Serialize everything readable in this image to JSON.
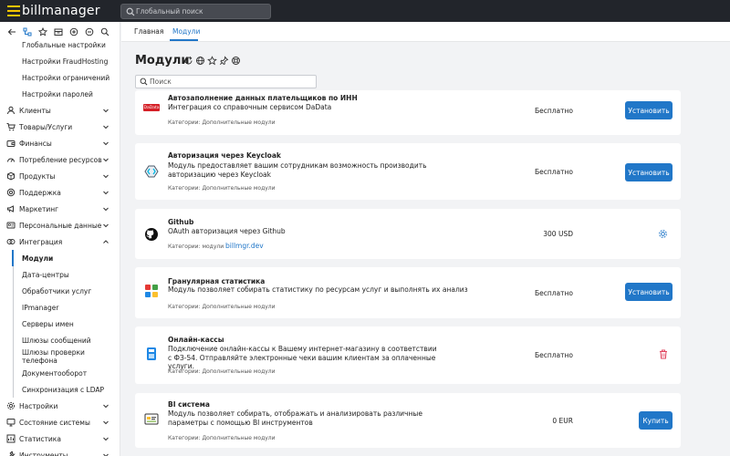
{
  "app": {
    "logo_text": "billmanager",
    "accent": "#2177c8"
  },
  "global_search": {
    "placeholder": "Глобальный поиск"
  },
  "tabs": [
    {
      "label": "Главная",
      "active": false
    },
    {
      "label": "Модули",
      "active": true
    }
  ],
  "sidebar": {
    "toolbar_icons": [
      "back-arrow-icon",
      "sitemap-icon",
      "star-icon",
      "archive-icon",
      "plus-circle-icon",
      "minus-circle-icon",
      "search-icon"
    ],
    "items": [
      {
        "label": "Глобальные настройки",
        "type": "sub"
      },
      {
        "label": "Настройки FraudHosting",
        "type": "sub"
      },
      {
        "label": "Настройки ограничений",
        "type": "sub"
      },
      {
        "label": "Настройки паролей",
        "type": "sub"
      },
      {
        "label": "Клиенты",
        "type": "group",
        "icon": "user-icon"
      },
      {
        "label": "Товары/Услуги",
        "type": "group",
        "icon": "cart-icon"
      },
      {
        "label": "Финансы",
        "type": "group",
        "icon": "wallet-icon"
      },
      {
        "label": "Потребление ресурсов",
        "type": "group",
        "icon": "meter-icon"
      },
      {
        "label": "Продукты",
        "type": "group",
        "icon": "box-icon"
      },
      {
        "label": "Поддержка",
        "type": "group",
        "icon": "support-icon"
      },
      {
        "label": "Маркетинг",
        "type": "group",
        "icon": "megaphone-icon"
      },
      {
        "label": "Персональные данные",
        "type": "group",
        "icon": "id-card-icon"
      },
      {
        "label": "Интеграция",
        "type": "group",
        "icon": "integration-icon",
        "expanded": true
      },
      {
        "label": "Модули",
        "type": "sub",
        "active": true
      },
      {
        "label": "Дата-центры",
        "type": "sub"
      },
      {
        "label": "Обработчики услуг",
        "type": "sub"
      },
      {
        "label": "IPmanager",
        "type": "sub"
      },
      {
        "label": "Серверы имен",
        "type": "sub"
      },
      {
        "label": "Шлюзы сообщений",
        "type": "sub"
      },
      {
        "label": "Шлюзы проверки телефона",
        "type": "sub"
      },
      {
        "label": "Документооборот",
        "type": "sub"
      },
      {
        "label": "Синхронизация с LDAP",
        "type": "sub"
      },
      {
        "label": "Настройки",
        "type": "group",
        "icon": "gear-icon"
      },
      {
        "label": "Состояние системы",
        "type": "group",
        "icon": "monitor-icon"
      },
      {
        "label": "Статистика",
        "type": "group",
        "icon": "chart-icon"
      },
      {
        "label": "Инструменты",
        "type": "group",
        "icon": "tools-icon"
      }
    ]
  },
  "page": {
    "title": "Модули",
    "search_placeholder": "Поиск"
  },
  "modules": [
    {
      "name": "Автозаполнение данных плательщиков по ИНН",
      "description": "Интеграция со справочным сервисом DaData",
      "category_label": "Категории: Дополнительные модули",
      "category_link": "",
      "price": "Бесплатно",
      "action": "Установить",
      "icon": "dadata-logo-icon",
      "icon_text": "DaData"
    },
    {
      "name": "Авторизация через Keycloak",
      "description": "Модуль предоставляет вашим сотрудникам возможность производить авторизацию через Keycloak",
      "category_label": "Категории: Дополнительные модули",
      "category_link": "",
      "price": "Бесплатно",
      "action": "Установить",
      "icon": "keycloak-icon"
    },
    {
      "name": "Github",
      "description": "OAuth авторизация через Github",
      "category_label": "Категории: модули ",
      "category_link": "billmgr.dev",
      "price": "300 USD",
      "action": "",
      "icon": "github-icon"
    },
    {
      "name": "Гранулярная статистика",
      "description": "Модуль позволяет собирать статистику по ресурсам услуг и выполнять их анализ",
      "category_label": "Категории: Дополнительные модули",
      "category_link": "",
      "price": "Бесплатно",
      "action": "Установить",
      "icon": "squares-icon"
    },
    {
      "name": "Онлайн-кассы",
      "description": "Подключение онлайн-кассы к Вашему интернет-магазину в соответствии с ФЗ-54. Отправляйте электронные чеки вашим клиентам за оплаченные услуги.",
      "category_label": "Категории: Дополнительные модули",
      "category_link": "",
      "price": "Бесплатно",
      "action": "",
      "icon": "cash-register-icon"
    },
    {
      "name": "BI система",
      "description": "Модуль позволяет собирать, отображать и анализировать различные параметры с помощью BI инструментов",
      "category_label": "Категории: Дополнительные модули",
      "category_link": "",
      "price": "0 EUR",
      "action": "Купить",
      "icon": "bi-dashboard-icon"
    }
  ]
}
